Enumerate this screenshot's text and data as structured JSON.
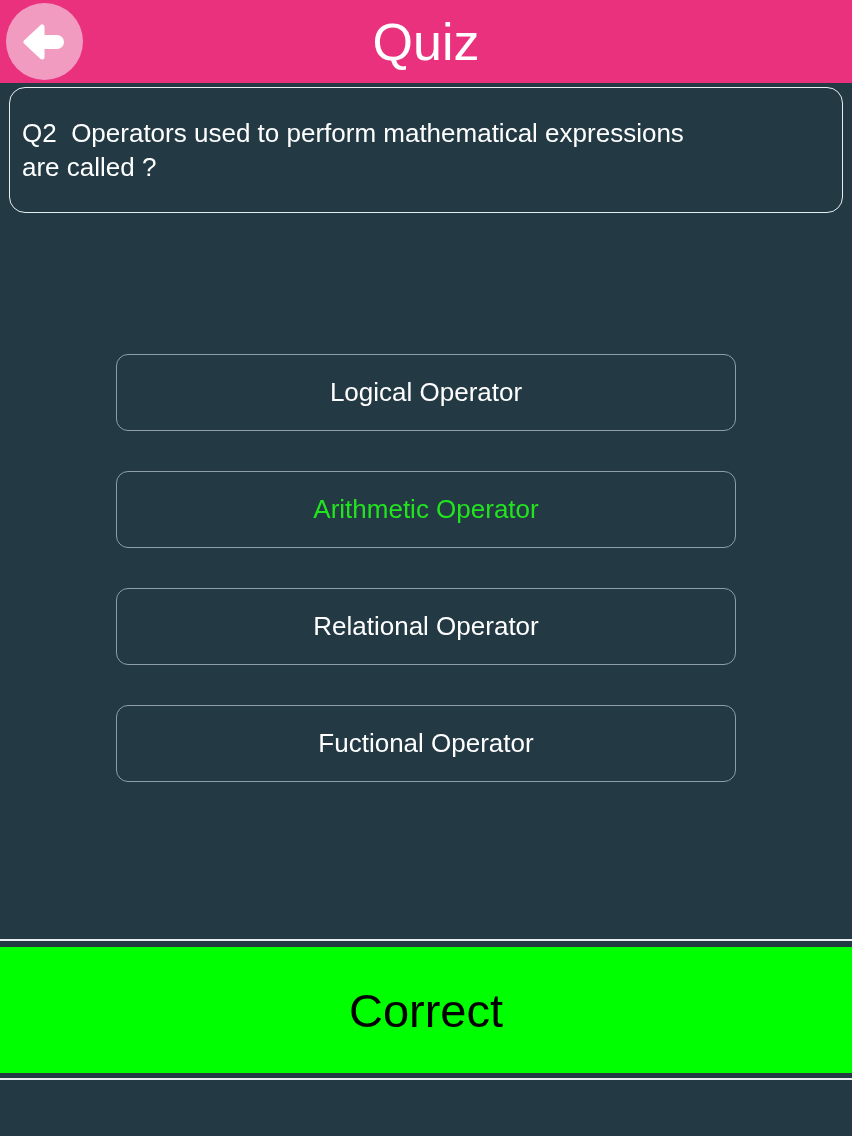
{
  "header": {
    "title": "Quiz"
  },
  "question": {
    "text": "Q2  Operators used to perform mathematical expressions are called ?"
  },
  "options": [
    {
      "label": "Logical Operator",
      "selected": false
    },
    {
      "label": "Arithmetic Operator",
      "selected": true
    },
    {
      "label": "Relational Operator",
      "selected": false
    },
    {
      "label": "Fuctional Operator",
      "selected": false
    }
  ],
  "result": {
    "text": "Correct",
    "correct": true
  }
}
